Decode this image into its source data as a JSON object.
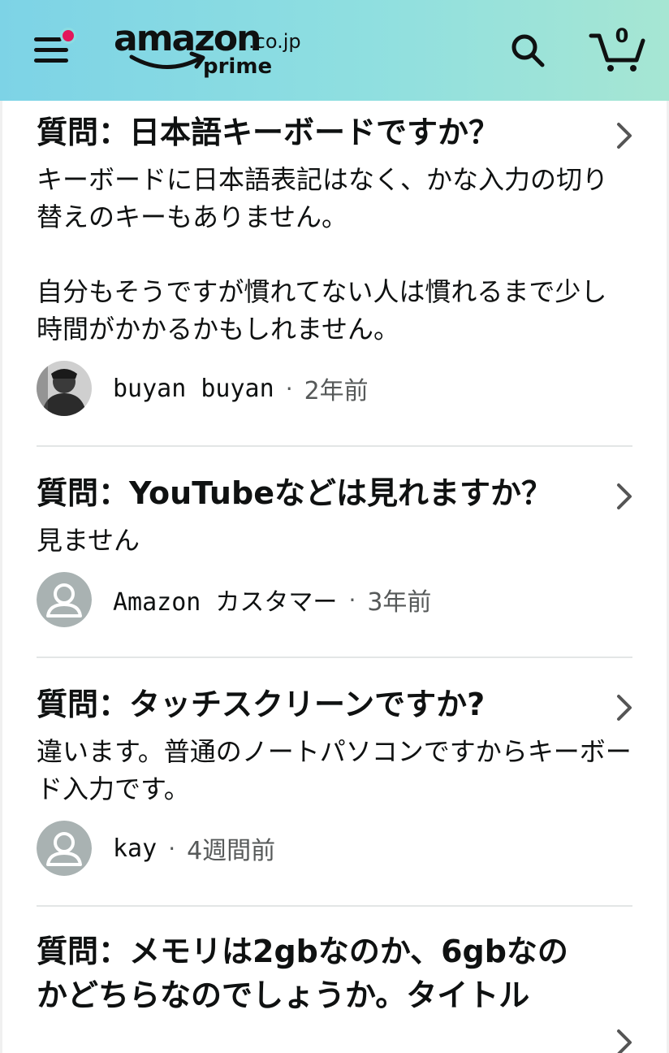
{
  "header": {
    "logo_word": "amazon",
    "logo_tld": ".co.jp",
    "logo_prime": "prime",
    "cart_count": "0",
    "accent": "#e3165b"
  },
  "qa_items": [
    {
      "question": "質問：日本語キーボードですか？",
      "answer": "キーボードに日本語表記はなく、かな入力の切り替えのキーもありません。\n\n自分もそうですが慣れてない人は慣れるまで少し時間がかかるかもしれません。",
      "author": "buyan buyan",
      "time": "2年前",
      "avatar": "photo"
    },
    {
      "question": "質問：YouTubeなどは見れますか？",
      "answer": "見ません",
      "author": "Amazon カスタマー",
      "time": "3年前",
      "avatar": "default-user-icon"
    },
    {
      "question": "質問：タッチスクリーンですか?",
      "answer": "違います。普通のノートパソコンですからキーボード入力です。",
      "author": "kay",
      "time": "4週間前",
      "avatar": "default-user-icon"
    },
    {
      "question": "質問：メモリは2gbなのか、6gbなのかどちらなのでしょうか。タイトル"
    }
  ]
}
